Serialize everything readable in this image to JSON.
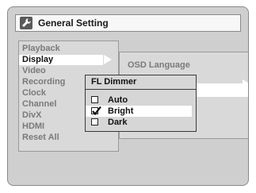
{
  "window": {
    "title": "General Setting",
    "icon": "wrench-icon"
  },
  "menu": {
    "items": [
      {
        "label": "Playback",
        "selected": false
      },
      {
        "label": "Display",
        "selected": true
      },
      {
        "label": "Video",
        "selected": false
      },
      {
        "label": "Recording",
        "selected": false
      },
      {
        "label": "Clock",
        "selected": false
      },
      {
        "label": "Channel",
        "selected": false
      },
      {
        "label": "DivX",
        "selected": false
      },
      {
        "label": "HDMI",
        "selected": false
      },
      {
        "label": "Reset All",
        "selected": false
      }
    ]
  },
  "submenu": {
    "header": "OSD Language"
  },
  "popup": {
    "title": "FL Dimmer",
    "options": [
      {
        "label": "Auto",
        "checked": false,
        "selected": false
      },
      {
        "label": "Bright",
        "checked": true,
        "selected": true
      },
      {
        "label": "Dark",
        "checked": false,
        "selected": false
      }
    ]
  },
  "colors": {
    "background": "#cfcfcf",
    "highlight": "#ffffff",
    "dim_text": "#7a7a7a",
    "active_text": "#111111"
  }
}
